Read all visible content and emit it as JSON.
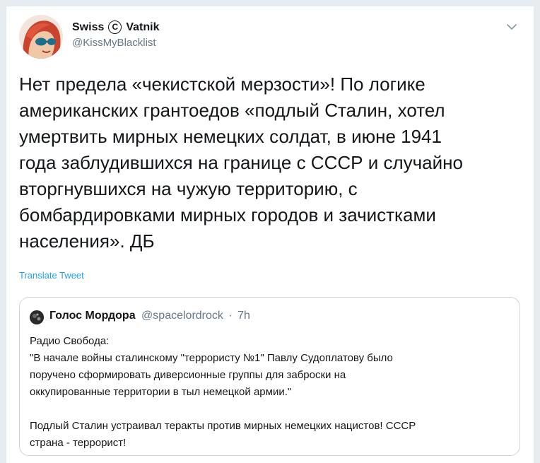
{
  "tweet": {
    "author": {
      "name_part1": "Swiss",
      "copyright_symbol": "C",
      "name_part2": "Vatnik",
      "handle": "@KissMyBlacklist"
    },
    "text_lines": [
      "Нет предела «чекистской мерзости»! По логике",
      "американских грантоедов «подлый Сталин, хотел",
      "умертвить мирных немецких солдат, в июне 1941",
      "года заблудившихся на границе с СССР и случайно",
      "вторгнувшихся на чужую территорию, с",
      "бомбардировками мирных городов и зачистками",
      "населения». ДБ"
    ],
    "translate_label": "Translate Tweet",
    "menu_icon": "chevron-down-icon"
  },
  "quote": {
    "name": "Голос Мордора",
    "handle": "@spacelordrock",
    "separator": "·",
    "time": "7h",
    "lines": [
      "Радио Свобода:",
      "\"В начале войны сталинскому \"террористу №1\" Павлу Судоплатову было",
      "поручено сформировать диверсионные группы для заброски на",
      "оккупированные территории в тыл немецкой армии.\"",
      "",
      "Подлый Сталин устраивал теракты против мирных немецких нацистов! СССР",
      "страна - террорист!"
    ]
  },
  "colors": {
    "link": "#1da1f2",
    "text_primary": "#14171a",
    "text_secondary": "#657786",
    "border": "#ccd6dd"
  }
}
